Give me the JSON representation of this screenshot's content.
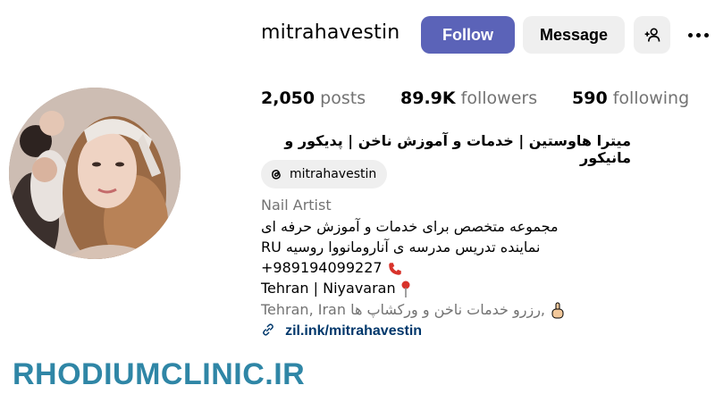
{
  "profile": {
    "username": "mitrahavestin",
    "full_name": "میترا هاوستین | خدمات و آموزش ناخن | پدیکور و مانیکور",
    "category": "Nail Artist",
    "threads_handle": "mitrahavestin"
  },
  "actions": {
    "follow_label": "Follow",
    "message_label": "Message",
    "suggest_icon": "add-person-icon",
    "more_icon": "more-options-icon"
  },
  "stats": {
    "posts_count": "2,050",
    "posts_label": "posts",
    "followers_count": "89.9K",
    "followers_label": "followers",
    "following_count": "590",
    "following_label": "following"
  },
  "bio": {
    "line1": "مجموعه متخصص برای خدمات و آموزش حرفه ای",
    "line2": "نماینده تدریس مدرسه ی آنارومانووا روسیه RU",
    "line3": "+989194099227",
    "line4": "Tehran | Niyavaran",
    "line5": "Tehran, Iran رزرو خدمات ناخن و ورکشاپ ها,",
    "link": "zil.ink/mitrahavestin"
  },
  "watermark": {
    "text": "RHODIUMCLINIC.IR"
  },
  "colors": {
    "follow_button": "#5b63b8",
    "secondary_button": "#efefef",
    "link": "#00376b",
    "muted_text": "#737373",
    "watermark": "#2f86a6"
  }
}
